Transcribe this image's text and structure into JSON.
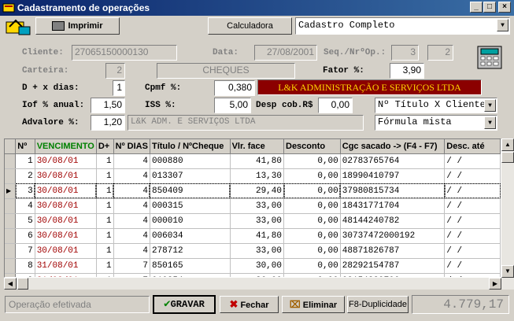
{
  "window": {
    "title": "Cadastramento de operações"
  },
  "toolbar": {
    "print_label": "Imprimir",
    "calculator_label": "Calculadora",
    "mode_value": "Cadastro Completo"
  },
  "form": {
    "cliente_label": "Cliente:",
    "cliente_value": "27065150000130",
    "cliente_name": "CHEQUES",
    "data_label": "Data:",
    "data_value": "27/08/2001",
    "seq_label": "Seq./NrºOp.:",
    "seq_value": "3",
    "nrop_value": "2",
    "carteira_label": "Carteira:",
    "carteira_value": "2",
    "fator_label": "Fator %:",
    "fator_value": "3,90",
    "dias_label": "D + x dias:",
    "dias_value": "1",
    "cpmf_label": "Cpmf   %:",
    "cpmf_value": "0,380",
    "empresa_banner": "L&K ADMINISTRAÇÃO E SERVIÇOS LTDA",
    "iof_label": "Iof % anual:",
    "iof_value": "1,50",
    "iss_label": "ISS    %:",
    "iss_value": "5,00",
    "desp_label": "Desp cob.R$",
    "desp_value": "0,00",
    "titulo_combo": "Nº Título X Cliente",
    "advalore_label": "Advalore %:",
    "advalore_value": "1,20",
    "empresa_short": "L&K ADM. E SERVIÇOS LTDA",
    "formula_combo": "Fórmula mista"
  },
  "grid": {
    "headers": [
      "Nº",
      "VENCIMENTO",
      "D+",
      "Nº DIAS",
      "Título / NºCheque",
      "Vlr. face",
      "Desconto",
      "Cgc sacado -> (F4 - F7)",
      "Desc. até"
    ],
    "rows": [
      [
        "1",
        "30/08/01",
        "1",
        "4",
        "000880",
        "41,80",
        "0,00",
        "02783765764",
        "/  /"
      ],
      [
        "2",
        "30/08/01",
        "1",
        "4",
        "013307",
        "13,30",
        "0,00",
        "18990410797",
        "/  /"
      ],
      [
        "3",
        "30/08/01",
        "1",
        "4",
        "850409",
        "29,40",
        "0,00",
        "37980815734",
        "/  /"
      ],
      [
        "4",
        "30/08/01",
        "1",
        "4",
        "000315",
        "33,00",
        "0,00",
        "18431771704",
        "/  /"
      ],
      [
        "5",
        "30/08/01",
        "1",
        "4",
        "000010",
        "33,00",
        "0,00",
        "48144240782",
        "/  /"
      ],
      [
        "6",
        "30/08/01",
        "1",
        "4",
        "006034",
        "41,80",
        "0,00",
        "30737472000192",
        "/  /"
      ],
      [
        "7",
        "30/08/01",
        "1",
        "4",
        "278712",
        "33,00",
        "0,00",
        "48871826787",
        "/  /"
      ],
      [
        "8",
        "31/08/01",
        "1",
        "7",
        "850165",
        "30,00",
        "0,00",
        "28292154787",
        "/  /"
      ],
      [
        "9",
        "31/08/01",
        "1",
        "7",
        "010354",
        "26,00",
        "0,00",
        "08154229706",
        "/  /"
      ]
    ]
  },
  "status": {
    "message": "Operação efetivada",
    "save_label": "GRAVAR",
    "close_label": "Fechar",
    "delete_label": "Eliminar",
    "dup_label": "F8-Duplicidade",
    "total": "4.779,17"
  }
}
